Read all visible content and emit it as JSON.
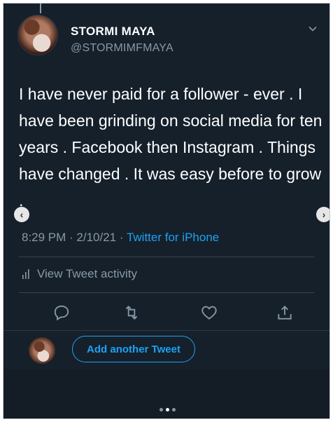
{
  "profile": {
    "name": "STORMI MAYA",
    "handle": "@STORMIMFMAYA"
  },
  "tweet": {
    "text": "I have never paid for a follower - ever . I have been grinding on social media for ten years . Facebook then Instagram . Things have changed . It was easy before to grow .",
    "time": "8:29 PM · 2/10/21 ·",
    "source": "Twitter for iPhone"
  },
  "activity": {
    "label": "View Tweet activity"
  },
  "actions": {
    "reply_icon": "reply-icon",
    "retweet_icon": "retweet-icon",
    "like_icon": "heart-icon",
    "share_icon": "share-icon"
  },
  "reply": {
    "button_label": "Add another Tweet"
  },
  "pager": {
    "prev": "‹",
    "next": "›",
    "page_count": 3,
    "current_index": 1
  },
  "colors": {
    "background": "#15202b",
    "accent": "#1da1f2",
    "secondary_text": "#8899a6"
  }
}
